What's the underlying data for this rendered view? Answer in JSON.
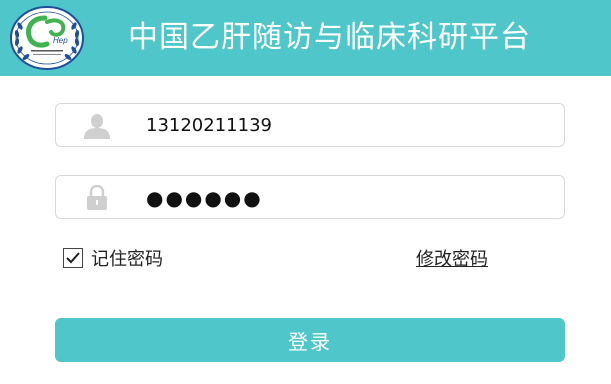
{
  "header": {
    "title": "中国乙肝随访与临床科研平台",
    "logo": {
      "text": "Hep",
      "icon": "hepatitis-logo"
    }
  },
  "form": {
    "username": {
      "value": "13120211139",
      "icon": "user-icon"
    },
    "password": {
      "value": "●●●●●●",
      "icon": "lock-icon"
    },
    "remember": {
      "label": "记住密码",
      "checked": true
    },
    "change_password_label": "修改密码",
    "login_label": "登录"
  },
  "colors": {
    "accent": "#4fc6ca",
    "field_border": "#d8d8d8",
    "icon_gray": "#cfcfcf"
  }
}
